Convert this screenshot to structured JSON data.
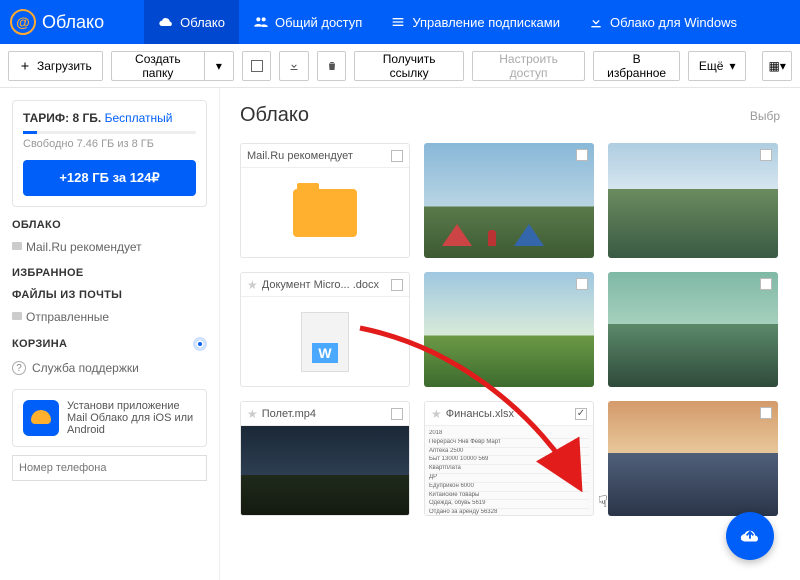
{
  "logo": "Облако",
  "nav": {
    "cloud": "Облако",
    "shared": "Общий доступ",
    "subs": "Управление подписками",
    "win": "Облако для Windows"
  },
  "toolbar": {
    "upload": "Загрузить",
    "newfolder": "Создать папку",
    "getlink": "Получить ссылку",
    "access": "Настроить доступ",
    "fav": "В избранное",
    "more": "Ещё"
  },
  "tariff": {
    "label": "ТАРИФ: 8 ГБ.",
    "plan": "Бесплатный",
    "usage": "Свободно 7.46 ГБ из 8 ГБ",
    "upgrade": "+128 ГБ за 124₽"
  },
  "sidebar": {
    "cloud_title": "ОБЛАКО",
    "cloud_item": "Mail.Ru рекомендует",
    "fav_title": "ИЗБРАННОЕ",
    "mail_title": "ФАЙЛЫ ИЗ ПОЧТЫ",
    "mail_item": "Отправленные",
    "trash_title": "КОРЗИНА",
    "support": "Служба поддержки"
  },
  "promo": {
    "text": "Установи приложение Mail Облако для iOS или Android",
    "placeholder": "Номер телефона"
  },
  "page": {
    "title": "Облако",
    "select": "Выбр"
  },
  "tiles": {
    "rec": "Mail.Ru рекомендует",
    "doc": "Документ Micro... .docx",
    "vid": "Полет.mp4",
    "xls": "Финансы.xlsx"
  },
  "xlsx_rows": [
    "2018",
    "Перерасч    Янв    Февр    Март",
    "Аптека    2500",
    "Быт    13000    10000    569",
    "Квартплата",
    "ДР",
    "Едуприкон    6000",
    "Китайские товары",
    "Одежда, обувь    5619",
    "Отдано за аренду    56328"
  ]
}
